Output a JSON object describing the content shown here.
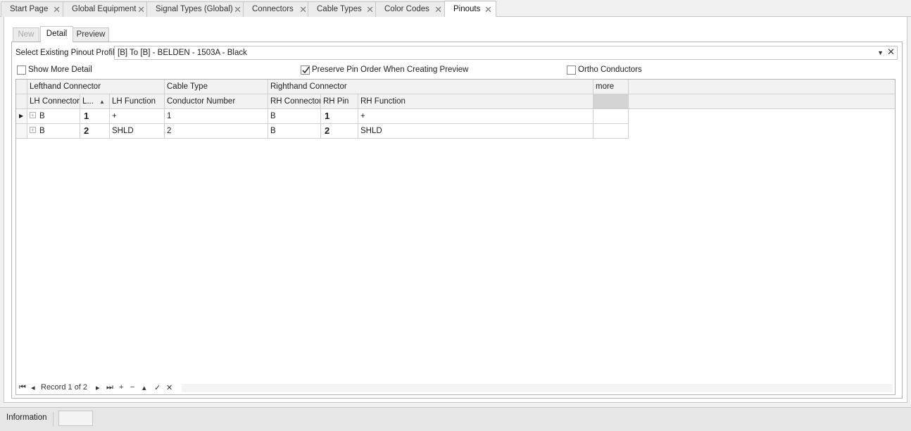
{
  "doc_tabs": [
    {
      "label": "Start Page",
      "active": false
    },
    {
      "label": "Global Equipment",
      "active": false
    },
    {
      "label": "Signal Types (Global)",
      "active": false
    },
    {
      "label": "Connectors",
      "active": false
    },
    {
      "label": "Cable Types",
      "active": false
    },
    {
      "label": "Color Codes",
      "active": false
    },
    {
      "label": "Pinouts",
      "active": true
    }
  ],
  "sub_tabs": [
    {
      "label": "New",
      "state": "disabled"
    },
    {
      "label": "Detail",
      "state": "active"
    },
    {
      "label": "Preview",
      "state": "normal"
    }
  ],
  "profile": {
    "label": "Select Existing Pinout Profile",
    "value": "[B] To [B] - BELDEN - 1503A - Black"
  },
  "options": {
    "show_more_detail": {
      "label": "Show More Detail",
      "checked": false
    },
    "preserve_pin_order": {
      "label": "Preserve Pin Order When Creating Preview",
      "checked": true
    },
    "ortho_conductors": {
      "label": "Ortho Conductors",
      "checked": false
    }
  },
  "grid": {
    "bands": [
      "Lefthand Connector",
      "Cable Type",
      "Righthand Connector",
      "more"
    ],
    "columns": [
      "LH Connector",
      "L...",
      "LH Function",
      "Conductor Number",
      "RH Connector",
      "RH Pin",
      "RH Function"
    ],
    "rows": [
      {
        "lh_connector": "B",
        "lh_pin": "1",
        "lh_function": "+",
        "conductor": "1",
        "rh_connector": "B",
        "rh_pin": "1",
        "rh_function": "+"
      },
      {
        "lh_connector": "B",
        "lh_pin": "2",
        "lh_function": "SHLD",
        "conductor": "2",
        "rh_connector": "B",
        "rh_pin": "2",
        "rh_function": "SHLD"
      }
    ]
  },
  "navigator": {
    "first": "⏮",
    "prev": "◂",
    "record_text": "Record 1 of 2",
    "next": "▸",
    "last": "⏭",
    "add": "+",
    "remove": "−",
    "up": "▴",
    "confirm": "✓",
    "cancel": "✕"
  },
  "status": {
    "label": "Information"
  },
  "icons": {
    "close": "close-icon",
    "expand": "plus-box-icon",
    "row_indicator": "caret-right-icon"
  }
}
